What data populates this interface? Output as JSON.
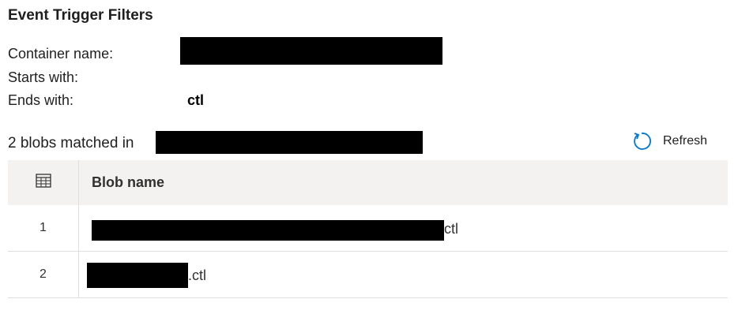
{
  "section_title": "Event Trigger Filters",
  "filters": {
    "container_label": "Container name:",
    "starts_label": "Starts with:",
    "ends_label": "Ends with:",
    "ends_value": "ctl"
  },
  "results": {
    "matched_prefix": "2 blobs matched in",
    "refresh_label": "Refresh"
  },
  "table": {
    "header_name": "Blob name",
    "rows": [
      {
        "index": "1",
        "suffix": "ctl"
      },
      {
        "index": "2",
        "suffix": ".ctl"
      }
    ]
  },
  "icons": {
    "table": "table-grid-icon",
    "refresh": "refresh-icon"
  },
  "colors": {
    "header_bg": "#f3f2f1",
    "refresh_blue": "#0078d4",
    "redaction": "#000000"
  }
}
